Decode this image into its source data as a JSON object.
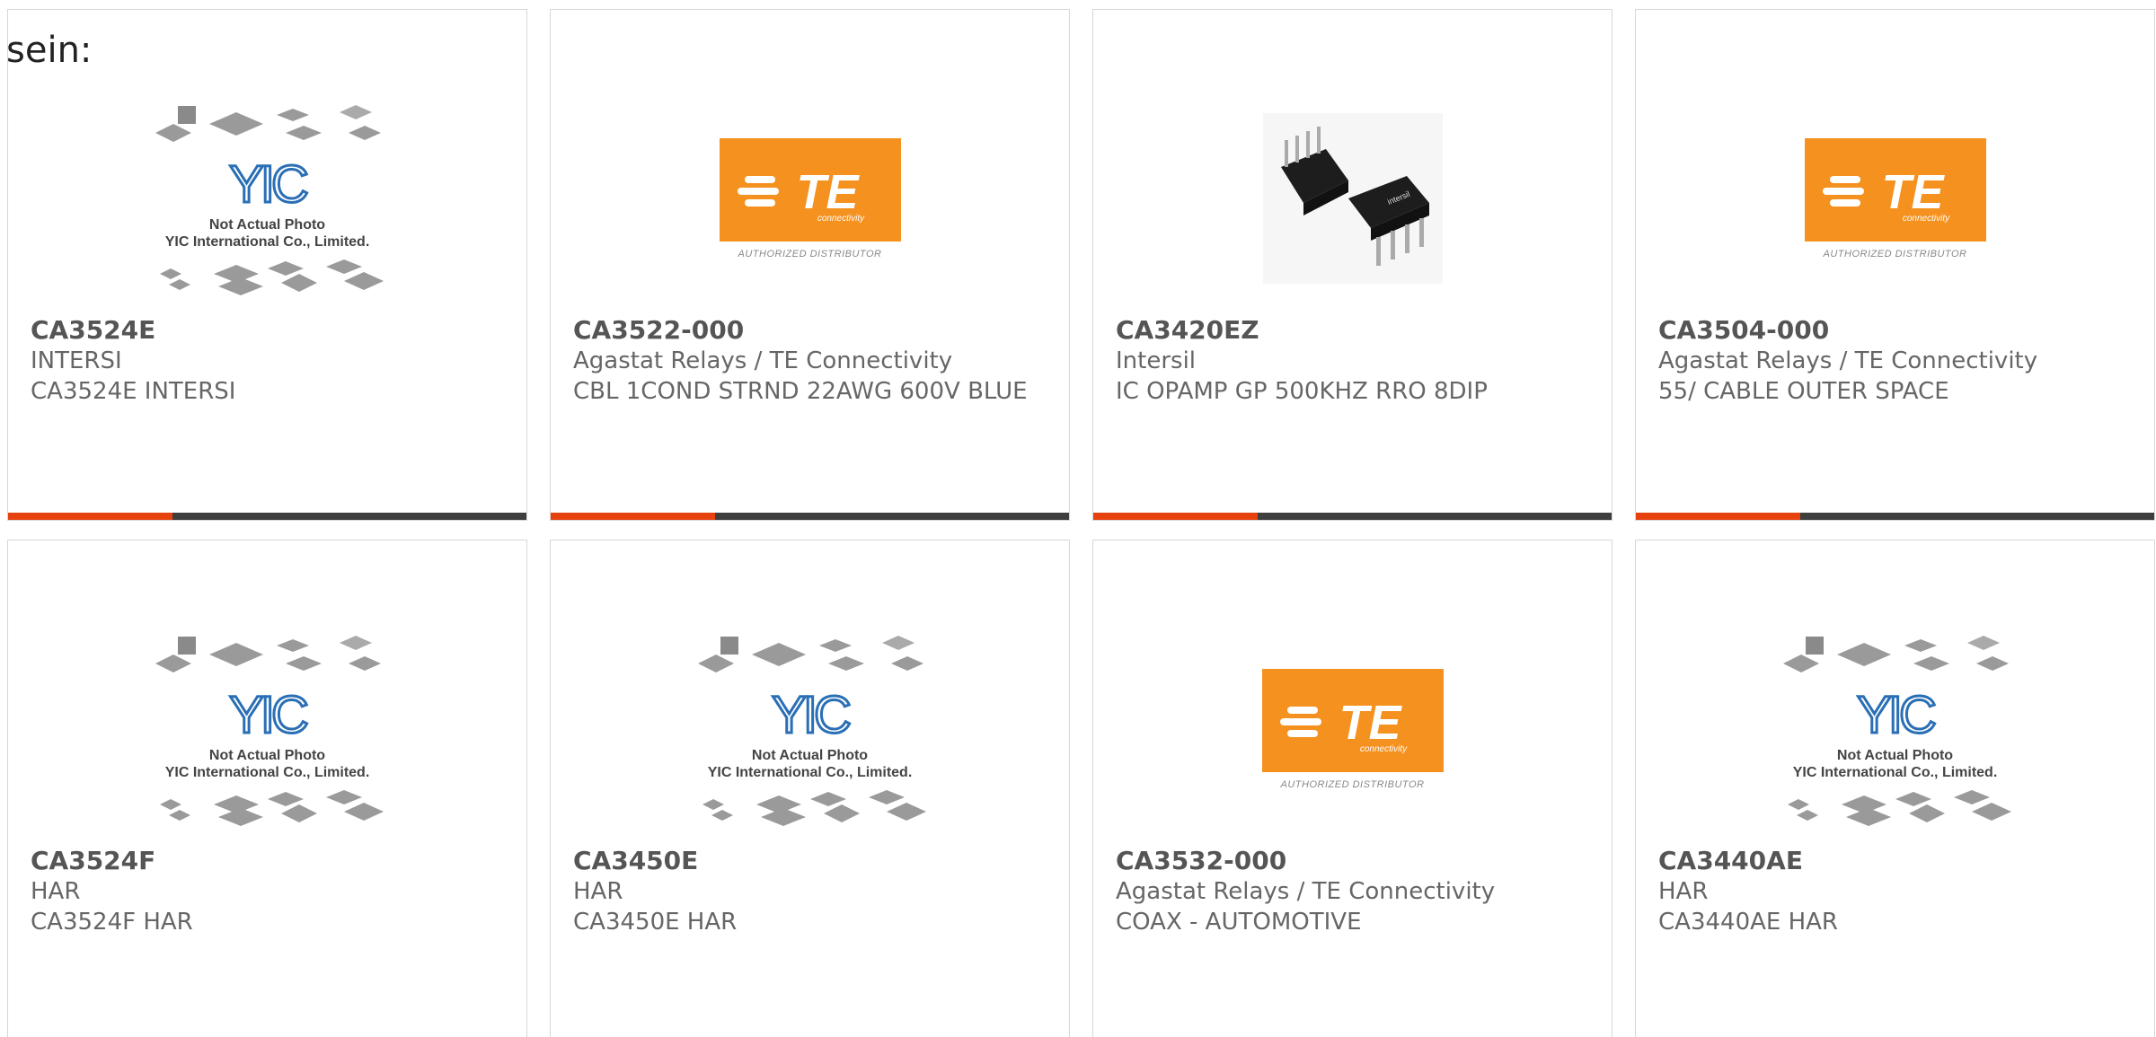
{
  "heading": "sein:",
  "products": [
    {
      "image": "yic-placeholder",
      "part": "CA3524E",
      "maker": "INTERSI",
      "desc": "CA3524E INTERSI"
    },
    {
      "image": "te-logo",
      "part": "CA3522-000",
      "maker": "Agastat Relays / TE Connectivity",
      "desc": "CBL 1COND STRND 22AWG 600V BLUE"
    },
    {
      "image": "chip-photo",
      "part": "CA3420EZ",
      "maker": "Intersil",
      "desc": "IC OPAMP GP 500KHZ RRO 8DIP"
    },
    {
      "image": "te-logo",
      "part": "CA3504-000",
      "maker": "Agastat Relays / TE Connectivity",
      "desc": "55/ CABLE OUTER SPACE"
    },
    {
      "image": "yic-placeholder",
      "part": "CA3524F",
      "maker": "HAR",
      "desc": "CA3524F HAR"
    },
    {
      "image": "yic-placeholder",
      "part": "CA3450E",
      "maker": "HAR",
      "desc": "CA3450E HAR"
    },
    {
      "image": "te-logo",
      "part": "CA3532-000",
      "maker": "Agastat Relays / TE Connectivity",
      "desc": "COAX - AUTOMOTIVE"
    },
    {
      "image": "yic-placeholder",
      "part": "CA3440AE",
      "maker": "HAR",
      "desc": "CA3440AE HAR"
    }
  ],
  "logos": {
    "te_text": "TE",
    "te_sub_text": "connectivity",
    "te_caption": "AUTHORIZED DISTRIBUTOR",
    "yic_text": "YIC",
    "yic_caption_line1": "Not Actual Photo",
    "yic_caption_line2": "YIC International Co., Limited."
  },
  "colors": {
    "accent": "#e5420e",
    "bar": "#3e3e3e",
    "te_orange": "#f5911e",
    "yic_blue": "#2a6fb5"
  }
}
